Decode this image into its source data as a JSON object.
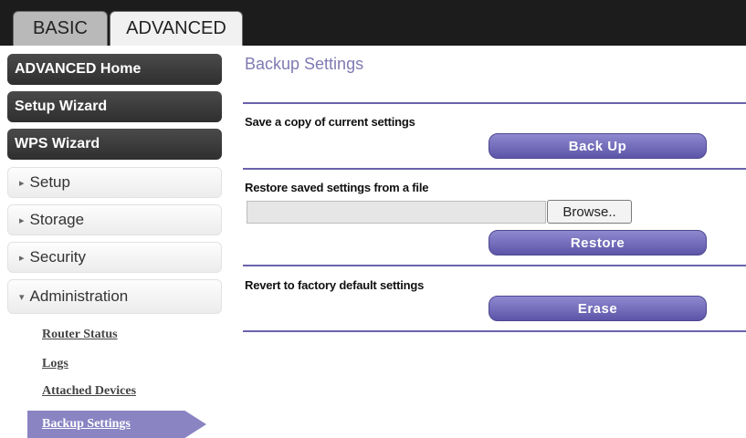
{
  "tabs": {
    "basic": "BASIC",
    "advanced": "ADVANCED"
  },
  "sidebar": {
    "dark_items": [
      "ADVANCED Home",
      "Setup Wizard",
      "WPS Wizard"
    ],
    "light_items": [
      {
        "arrow": "▸",
        "label": "Setup"
      },
      {
        "arrow": "▸",
        "label": "Storage"
      },
      {
        "arrow": "▸",
        "label": "Security"
      },
      {
        "arrow": "▾",
        "label": "Administration"
      }
    ],
    "sub_links": [
      "Router Status",
      "Logs",
      "Attached Devices"
    ],
    "active_sub": "Backup Settings"
  },
  "main": {
    "title": "Backup Settings",
    "save_label": "Save a copy of current settings",
    "backup_button": "Back Up",
    "restore_label": "Restore saved settings from a file",
    "file_value": "",
    "browse_button": "Browse..",
    "restore_button": "Restore",
    "revert_label": "Revert to factory default settings",
    "erase_button": "Erase"
  },
  "colors": {
    "accent": "#6a62ad",
    "button": "#5c55a8",
    "title": "#7f7ab3",
    "active_sub": "#8a84c3"
  }
}
